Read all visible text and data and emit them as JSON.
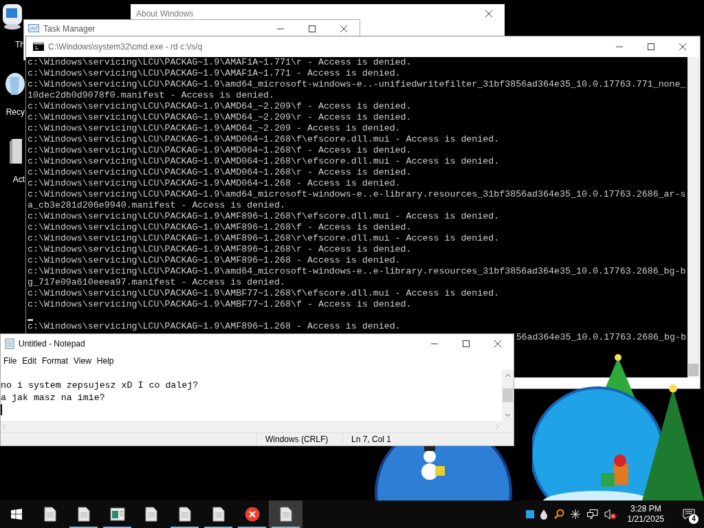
{
  "desktop_icons": [
    {
      "label": "Th",
      "kind": "computer"
    },
    {
      "label": "Recy",
      "kind": "recycle"
    },
    {
      "label": "Act",
      "kind": "document"
    }
  ],
  "about_window": {
    "title": "About Windows"
  },
  "task_manager": {
    "title": "Task Manager"
  },
  "cmd": {
    "title": "C:\\Windows\\system32\\cmd.exe - rd  c:\\/s/q",
    "lines": [
      {
        "kind": "text",
        "text": "c:\\Windows\\servicing\\LCU\\PACKAG~1.9\\AMAF1A~1.771\\r - Access is denied."
      },
      {
        "kind": "text",
        "text": "c:\\Windows\\servicing\\LCU\\PACKAG~1.9\\AMAF1A~1.771 - Access is denied."
      },
      {
        "kind": "text",
        "text": "c:\\Windows\\servicing\\LCU\\PACKAG~1.9\\amd64_microsoft-windows-e..-unifiedwritefilter_31bf3856ad364e35_10.0.17763.771_none_"
      },
      {
        "kind": "text",
        "text": "10dec2db0d9078f0.manifest - Access is denied."
      },
      {
        "kind": "text",
        "text": "c:\\Windows\\servicing\\LCU\\PACKAG~1.9\\AMD64_~2.209\\f - Access is denied."
      },
      {
        "kind": "text",
        "text": "c:\\Windows\\servicing\\LCU\\PACKAG~1.9\\AMD64_~2.209\\r - Access is denied."
      },
      {
        "kind": "text",
        "text": "c:\\Windows\\servicing\\LCU\\PACKAG~1.9\\AMD64_~2.209 - Access is denied."
      },
      {
        "kind": "text",
        "text": "c:\\Windows\\servicing\\LCU\\PACKAG~1.9\\AMD064~1.268\\f\\efscore.dll.mui - Access is denied."
      },
      {
        "kind": "text",
        "text": "c:\\Windows\\servicing\\LCU\\PACKAG~1.9\\AMD064~1.268\\f - Access is denied."
      },
      {
        "kind": "text",
        "text": "c:\\Windows\\servicing\\LCU\\PACKAG~1.9\\AMD064~1.268\\r\\efscore.dll.mui - Access is denied."
      },
      {
        "kind": "text",
        "text": "c:\\Windows\\servicing\\LCU\\PACKAG~1.9\\AMD064~1.268\\r - Access is denied."
      },
      {
        "kind": "text",
        "text": "c:\\Windows\\servicing\\LCU\\PACKAG~1.9\\AMD064~1.268 - Access is denied."
      },
      {
        "kind": "text",
        "text": "c:\\Windows\\servicing\\LCU\\PACKAG~1.9\\amd64_microsoft-windows-e..e-library.resources_31bf3856ad364e35_10.0.17763.2686_ar-s"
      },
      {
        "kind": "text",
        "text": "a_cb3e281d206e9940.manifest - Access is denied."
      },
      {
        "kind": "text",
        "text": "c:\\Windows\\servicing\\LCU\\PACKAG~1.9\\AMF896~1.268\\f\\efscore.dll.mui - Access is denied."
      },
      {
        "kind": "text",
        "text": "c:\\Windows\\servicing\\LCU\\PACKAG~1.9\\AMF896~1.268\\f - Access is denied."
      },
      {
        "kind": "text",
        "text": "c:\\Windows\\servicing\\LCU\\PACKAG~1.9\\AMF896~1.268\\r\\efscore.dll.mui - Access is denied."
      },
      {
        "kind": "text",
        "text": "c:\\Windows\\servicing\\LCU\\PACKAG~1.9\\AMF896~1.268\\r - Access is denied."
      },
      {
        "kind": "text",
        "text": "c:\\Windows\\servicing\\LCU\\PACKAG~1.9\\AMF896~1.268 - Access is denied."
      },
      {
        "kind": "text",
        "text": "c:\\Windows\\servicing\\LCU\\PACKAG~1.9\\amd64_microsoft-windows-e..e-library.resources_31bf3856ad364e35_10.0.17763.2686_bg-b"
      },
      {
        "kind": "text",
        "text": "g_717e09a610eeea97.manifest - Access is denied."
      },
      {
        "kind": "text",
        "text": "c:\\Windows\\servicing\\LCU\\PACKAG~1.9\\AMBF77~1.268\\f\\efscore.dll.mui - Access is denied."
      },
      {
        "kind": "text",
        "text": "c:\\Windows\\servicing\\LCU\\PACKAG~1.9\\AMBF77~1.268\\f - Access is denied."
      },
      {
        "kind": "cursor"
      },
      {
        "kind": "text",
        "text": "c:\\Windows\\servicing\\LCU\\PACKAG~1.9\\AMF896~1.268 - Access is denied."
      },
      {
        "kind": "partial",
        "text": "56ad364e35_10.0.17763.2686_bg-b"
      }
    ]
  },
  "notepad": {
    "title": "Untitled - Notepad",
    "menu": [
      "File",
      "Edit",
      "Format",
      "View",
      "Help"
    ],
    "lines": [
      "no i system zepsujesz xD I co dalej?",
      "a jak masz na imie?"
    ],
    "status": [
      "Windows (CRLF)",
      "Ln 7, Col 1"
    ]
  },
  "taskbar": {
    "items": [
      {
        "kind": "document",
        "running": false,
        "selected": false
      },
      {
        "kind": "document",
        "running": true,
        "selected": false
      },
      {
        "kind": "sheet",
        "running": true,
        "selected": false
      },
      {
        "kind": "document",
        "running": false,
        "selected": false
      },
      {
        "kind": "document",
        "running": true,
        "selected": false
      },
      {
        "kind": "document",
        "running": true,
        "selected": false
      },
      {
        "kind": "error",
        "running": true,
        "selected": false
      },
      {
        "kind": "document",
        "running": true,
        "selected": true
      }
    ],
    "time": "3:28 PM",
    "date": "1/21/2025",
    "notifications": "4"
  }
}
